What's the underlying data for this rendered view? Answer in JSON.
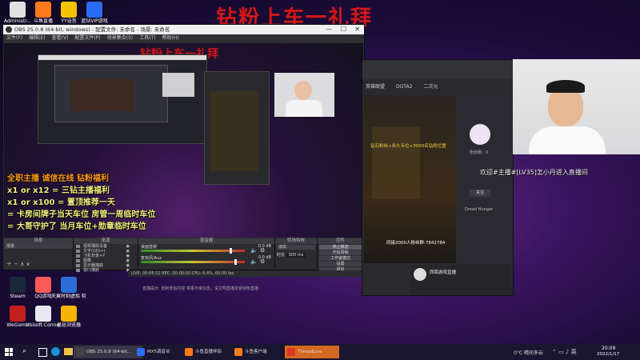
{
  "banner_text": "钻粉上车一礼拜",
  "desktop_icons": [
    {
      "name": "recycle-bin-icon",
      "label": "Administr...",
      "color": "#e0e0e0"
    },
    {
      "name": "douyu-icon",
      "label": "斗鱼直播",
      "color": "#ff7a1a"
    },
    {
      "name": "yy-icon",
      "label": "YY语音",
      "color": "#f3c300"
    },
    {
      "name": "vip-icon",
      "label": "蓝钻VIP游戏",
      "color": "#2a6df4"
    },
    {
      "name": "steam-icon",
      "label": "Steam",
      "color": "#1b2838"
    },
    {
      "name": "qq-music-icon",
      "label": "QQ游戏",
      "color": "#ff5a5a"
    },
    {
      "name": "tianyi-icon",
      "label": "天翼时刻虚拟 软件",
      "color": "#2c6ed6"
    },
    {
      "name": "wegame-icon",
      "label": "WeGame",
      "color": "#c42020"
    },
    {
      "name": "ubisoft-icon",
      "label": "Ubisoft Connect",
      "color": "#e8e8f4"
    },
    {
      "name": "star-browser-icon",
      "label": "星愿浏览器",
      "color": "#f6b400"
    }
  ],
  "obs": {
    "title": "OBS 25.0.8 (64-bit, windows) - 配置文件: 未命名 - 场景: 未命名",
    "menu": [
      "文件(F)",
      "编辑(E)",
      "查看(V)",
      "配置文件(P)",
      "场景集合(S)",
      "工具(T)",
      "帮助(H)"
    ],
    "preview_title": "钻粉上车一礼拜",
    "overlay_lines": [
      "全职主播 诚信在线 钻粉福利",
      "x1 or x12 = 三钻主播福利",
      "x1 or x100 = 置顶推荐一天",
      "= 卡房间牌子当天车位 房管一周临时车位",
      "= 大哥守护了 当月车位+勋章临时车位"
    ],
    "docks": {
      "scenes": "场景",
      "sources": "来源",
      "mixer": "混音器",
      "transitions": "转场特效",
      "controls": "控件"
    },
    "scene_item": "场景",
    "sources": [
      "视频捕获设备",
      "文字(GDI+)",
      "飞机背景+Y",
      "图像",
      "显示器捕获",
      "窗口捕获"
    ],
    "mixer": [
      {
        "name": "桌面音频",
        "db": "0.0 dB",
        "level": 0.85
      },
      {
        "name": "麦克风/Aux",
        "db": "0.0 dB",
        "level": 0.9
      }
    ],
    "transition": "淡出",
    "duration_label": "时长",
    "duration": "300 ms",
    "controls": [
      "停止推流",
      "开始录制",
      "工作室模式",
      "设置",
      "退出"
    ],
    "status": "LIVE: 00:06:52  REC: 00:00:00  CPU: 6.4%, 60.00 fps"
  },
  "live_app": {
    "tabs": [
      "英雄联盟",
      "DOTA2",
      "二次元"
    ],
    "welcome": "欢迎#主播#[LV35]怎小丹进入直播间",
    "danmu": "钻石粉丝+永久专位+3000名钻粉位置",
    "fans_count": "同接2000人粉丝群:7842784",
    "followers": "粉丝数：0",
    "follow_btn": "关注",
    "anchor_name": "西陌游戏直播",
    "rank_label": "Dread Hunger",
    "notice": "直播提示: 抵制低俗内容 举报不良信息，请文明直播享受绿色直播"
  },
  "taskbar": {
    "apps": [
      {
        "label": "OBS 25.0.8 (64-bit...",
        "color": "#444"
      },
      {
        "label": "MX5调音台",
        "color": "#2a6df4"
      },
      {
        "label": "斗鱼直播伴侣",
        "color": "#ff7a1a"
      },
      {
        "label": "斗鱼客户端",
        "color": "#ff7a1a"
      },
      {
        "label": "ThreadLive",
        "color": "#d32"
      }
    ],
    "weather": "0°C 晴间多云",
    "time": "20:09",
    "date": "2022/1/17"
  }
}
